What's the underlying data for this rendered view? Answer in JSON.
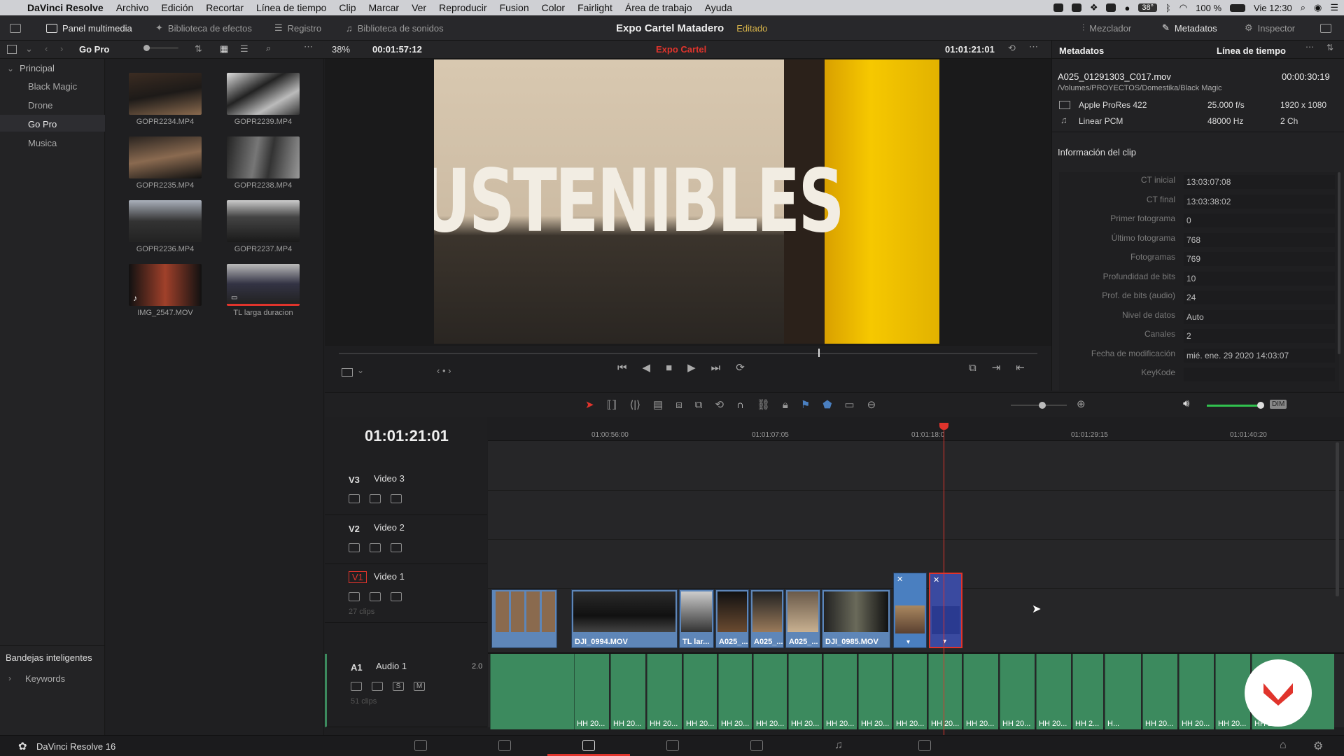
{
  "menubar": {
    "app": "DaVinci Resolve",
    "items": [
      "Archivo",
      "Edición",
      "Recortar",
      "Línea de tiempo",
      "Clip",
      "Marcar",
      "Ver",
      "Reproducir",
      "Fusion",
      "Color",
      "Fairlight",
      "Área de trabajo",
      "Ayuda"
    ],
    "battery": "100 %",
    "temp": "38°",
    "clock": "Vie 12:30"
  },
  "toolbar": {
    "media_pool": "Panel multimedia",
    "effects": "Biblioteca de efectos",
    "log": "Registro",
    "sounds": "Biblioteca de sonidos",
    "mixer": "Mezclador",
    "metadata": "Metadatos",
    "inspector": "Inspector"
  },
  "project": {
    "title": "Expo Cartel Matadero",
    "state": "Editado"
  },
  "subbar": {
    "bin": "Go Pro",
    "zoom": "38%",
    "timecode": "00:01:57:12",
    "timeline_name": "Expo Cartel",
    "record_tc": "01:01:21:01",
    "meta_tab": "Metadatos",
    "timeline_tab": "Línea de tiempo"
  },
  "bins": {
    "root": "Principal",
    "items": [
      "Black Magic",
      "Drone",
      "Go Pro",
      "Musica"
    ],
    "smart": "Bandejas inteligentes",
    "keywords": "Keywords"
  },
  "clips": [
    "GOPR2234.MP4",
    "GOPR2239.MP4",
    "GOPR2235.MP4",
    "GOPR2238.MP4",
    "GOPR2236.MP4",
    "GOPR2237.MP4",
    "IMG_2547.MOV",
    "TL larga duracion"
  ],
  "viewer": {
    "frame_text": "USTENIBLES"
  },
  "metadata": {
    "file": "A025_01291303_C017.mov",
    "duration": "00:00:30:19",
    "path": "/Volumes/PROYECTOS/Domestika/Black Magic",
    "codec": "Apple ProRes 422",
    "fps": "25.000 f/s",
    "resolution": "1920 x 1080",
    "audio_codec": "Linear PCM",
    "sample_rate": "48000 Hz",
    "channels_short": "2 Ch",
    "section": "Información del clip",
    "fields": [
      {
        "label": "CT inicial",
        "value": "13:03:07:08"
      },
      {
        "label": "CT final",
        "value": "13:03:38:02"
      },
      {
        "label": "Primer fotograma",
        "value": "0"
      },
      {
        "label": "Último fotograma",
        "value": "768"
      },
      {
        "label": "Fotogramas",
        "value": "769"
      },
      {
        "label": "Profundidad de bits",
        "value": "10"
      },
      {
        "label": "Prof. de bits (audio)",
        "value": "24"
      },
      {
        "label": "Nivel de datos",
        "value": "Auto"
      },
      {
        "label": "Canales",
        "value": "2"
      },
      {
        "label": "Fecha de modificación",
        "value": "mié. ene. 29 2020 14:03:07"
      },
      {
        "label": "KeyKode",
        "value": ""
      }
    ]
  },
  "timeline": {
    "tc": "01:01:21:01",
    "ruler": [
      "01:00:56:00",
      "01:01:07:05",
      "01:01:18:0",
      "01:01:29:15",
      "01:01:40:20"
    ],
    "tracks": [
      {
        "id": "V3",
        "name": "Video 3"
      },
      {
        "id": "V2",
        "name": "Video 2"
      },
      {
        "id": "V1",
        "name": "Video 1",
        "count": "27 clips"
      },
      {
        "id": "A1",
        "name": "Audio 1",
        "level": "2.0",
        "count": "51 clips"
      }
    ],
    "video_clips": [
      "DJI_0994.MOV",
      "TL lar...",
      "A025_...",
      "A025_...",
      "A025_...",
      "DJI_0985.MOV"
    ],
    "audio_clip_label": "HH 20...",
    "audio_short": "HH 2...",
    "audio_h": "H...",
    "dim": "DIM",
    "solo": "S",
    "mute": "M"
  },
  "footer": {
    "app": "DaVinci Resolve 16"
  },
  "colors": {
    "accent": "#e0342c",
    "selection": "#4a7fc0",
    "audio": "#3c8a5e"
  }
}
